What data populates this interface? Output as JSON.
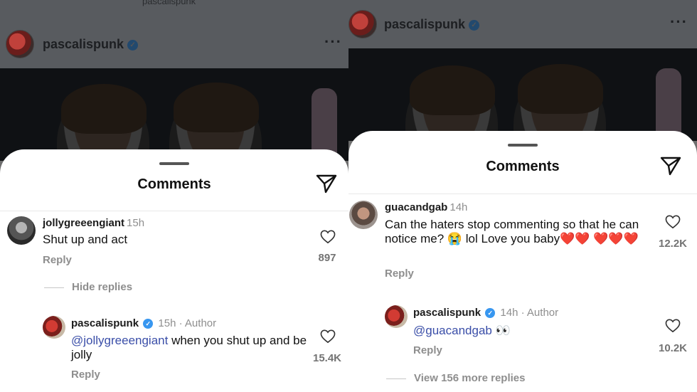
{
  "left": {
    "post_username": "pascalispunk",
    "top_username": "pascalispunk",
    "sheet_title": "Comments",
    "comments": [
      {
        "username": "jollygreeengiant",
        "time": "15h",
        "text": "Shut up and act",
        "reply": "Reply",
        "likes": "897"
      }
    ],
    "hide_replies": "Hide replies",
    "reply": {
      "username": "pascalispunk",
      "time": "15h",
      "author_label": "· Author",
      "mention": "@jollygreeengiant",
      "text": " when you shut up and be jolly",
      "reply": "Reply",
      "likes": "15.4K"
    }
  },
  "right": {
    "post_username": "pascalispunk",
    "sheet_title": "Comments",
    "comment": {
      "username": "guacandgab",
      "time": "14h",
      "text": "Can the haters stop commenting so that he can notice me? 😭 lol Love you baby❤️❤️ ❤️❤️❤️",
      "reply": "Reply",
      "likes": "12.2K"
    },
    "reply": {
      "username": "pascalispunk",
      "time": "14h",
      "author_label": "· Author",
      "mention": "@guacandgab",
      "text": " 👀",
      "reply": "Reply",
      "likes": "10.2K"
    },
    "view_more": "View 156 more replies"
  },
  "colors": {
    "verified": "#3897f0",
    "mention": "#3a4ea8",
    "muted": "#8e8e8e",
    "dimmed_header": "#585b5f"
  }
}
